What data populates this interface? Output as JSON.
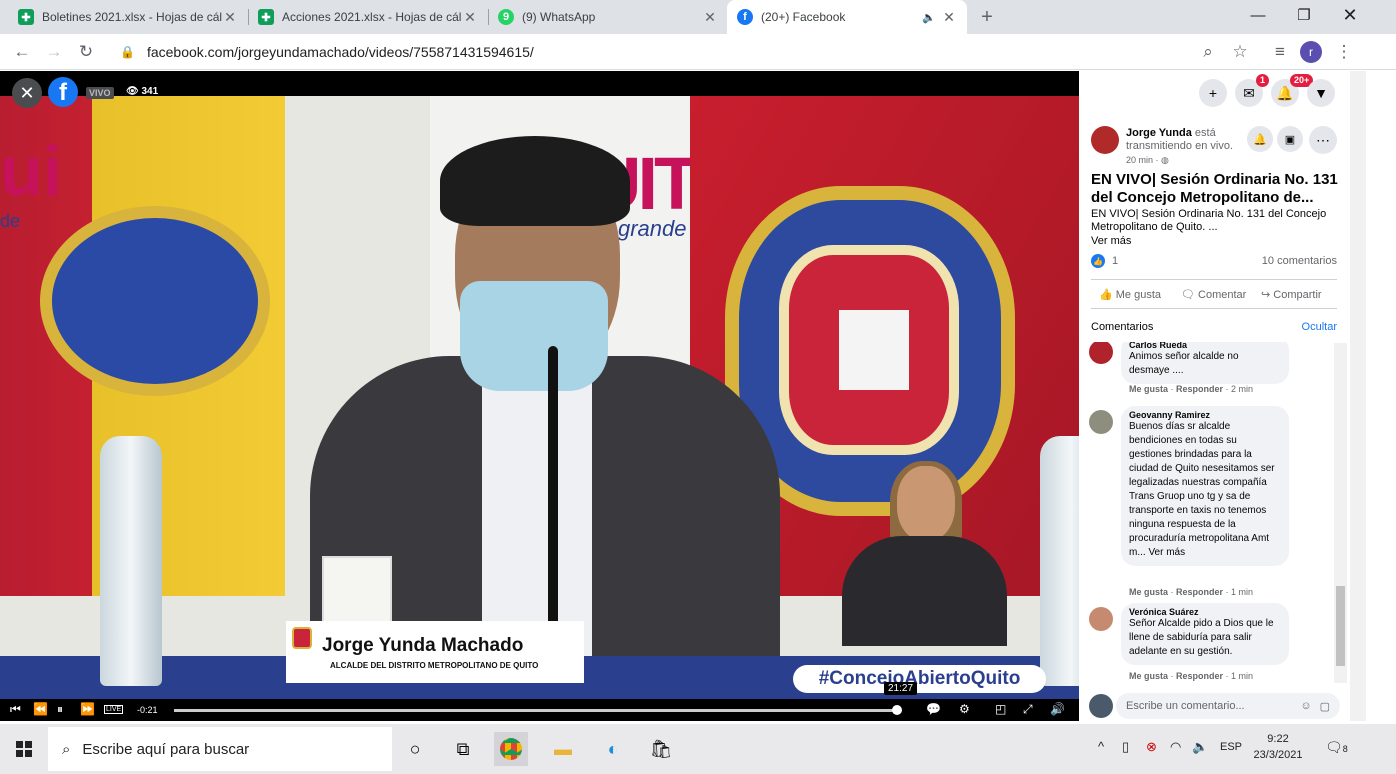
{
  "tabs": [
    {
      "title": "Boletines 2021.xlsx - Hojas de cál",
      "icon": "sheets-icon",
      "color": "#0f9d58"
    },
    {
      "title": "Acciones 2021.xlsx - Hojas de cál",
      "icon": "sheets-icon",
      "color": "#0f9d58"
    },
    {
      "title": "(9) WhatsApp",
      "icon": "whatsapp-icon",
      "color": "#25d366"
    },
    {
      "title": "(20+) Facebook",
      "icon": "facebook-icon",
      "color": "#1877f2"
    }
  ],
  "browser": {
    "url": "facebook.com/jorgeyundamachado/videos/755871431594615/",
    "new_tab": "+",
    "profile": "r"
  },
  "video": {
    "live_label": "VIVO",
    "viewers": "341",
    "nameplate_name": "Jorge Yunda Machado",
    "nameplate_sub": "ALCALDE DEL DISTRITO METROPOLITANO DE QUITO",
    "hashtag": "#ConcejoAbiertoQuito",
    "logo_text": "UIT",
    "logo_sub": "grande",
    "logo_left": "ui",
    "logo_left_sub": "de",
    "remaining": "-0:21",
    "elapsed_badge": "21:27",
    "progress": 0.99,
    "live_button": "LIVE"
  },
  "side": {
    "messenger_badge": "1",
    "notif_badge": "20+",
    "post_author": "Jorge Yunda",
    "post_status": "está transmitiendo en vivo.",
    "post_time": "20 min · ",
    "post_title": "EN VIVO| Sesión Ordinaria No. 131 del Concejo Metropolitano de...",
    "post_desc": "EN VIVO| Sesión Ordinaria No. 131 del Concejo Metropolitano de Quito. ...",
    "see_more": "Ver más",
    "likes": "1",
    "comments_count": "10 comentarios",
    "like_btn": "Me gusta",
    "comment_btn": "Comentar",
    "share_btn": "Compartir",
    "comments_title": "Comentarios",
    "hide": "Ocultar",
    "comments": [
      {
        "name": "Carlos Rueda",
        "text": "Animos señor alcalde no desmaye ....",
        "meta_like": "Me gusta",
        "meta_reply": "Responder",
        "meta_time": "2 min"
      },
      {
        "name": "Geovanny Ramirez",
        "text": "Buenos días sr alcalde bendiciones en todas su gestiones brindadas para la ciudad de Quito nesesitamos ser legalizadas nuestras compañía Trans Gruop uno tg y sa de transporte en taxis no tenemos ninguna respuesta de la procuraduría metropolitana Amt m... Ver más",
        "meta_like": "Me gusta",
        "meta_reply": "Responder",
        "meta_time": "1 min"
      },
      {
        "name": "Verónica Suárez",
        "text": "Señor Alcalde pido a Dios que le llene de sabiduría para salir adelante en su gestión.",
        "meta_like": "Me gusta",
        "meta_reply": "Responder",
        "meta_time": "1 min"
      }
    ],
    "comment_placeholder": "Escribe un comentario..."
  },
  "taskbar": {
    "search_placeholder": "Escribe aquí para buscar",
    "lang": "ESP",
    "time": "9:22",
    "date": "23/3/2021",
    "notif_count": "8"
  }
}
